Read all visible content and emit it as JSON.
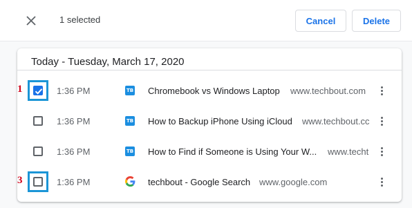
{
  "toolbar": {
    "close_icon": "close-icon",
    "selected_count": "1 selected",
    "cancel_label": "Cancel",
    "delete_label": "Delete"
  },
  "history": {
    "date_heading": "Today - Tuesday, March 17, 2020",
    "items": [
      {
        "time": "1:36 PM",
        "favicon": "TB",
        "title": "Chromebook vs Windows Laptop",
        "domain": "www.techbout.com",
        "checked": true,
        "marker": "1"
      },
      {
        "time": "1:36 PM",
        "favicon": "TB",
        "title": "How to Backup iPhone Using iCloud",
        "domain": "www.techbout.cc",
        "checked": false
      },
      {
        "time": "1:36 PM",
        "favicon": "TB",
        "title": "How to Find if Someone is Using Your W...",
        "domain": "www.techt",
        "checked": false
      },
      {
        "time": "1:36 PM",
        "favicon": "google-g-icon",
        "title": "techbout - Google Search",
        "domain": "www.google.com",
        "checked": false,
        "marker": "3"
      }
    ]
  },
  "colors": {
    "accent": "#1a73e8",
    "highlight_box": "#1b95d6",
    "marker": "#d0021b",
    "techbout_favicon": "#1b8ee0"
  }
}
